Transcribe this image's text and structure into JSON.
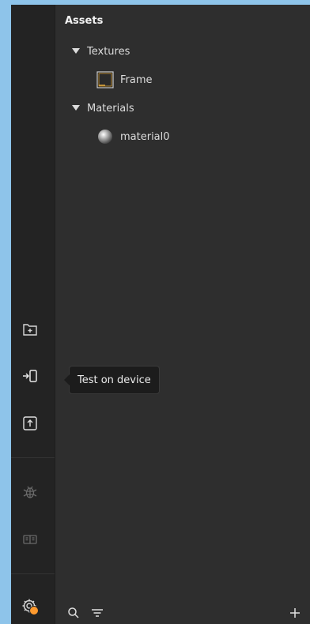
{
  "panel": {
    "title": "Assets"
  },
  "tree": {
    "textures": {
      "label": "Textures",
      "items": [
        {
          "label": "Frame",
          "icon": "texture-thumbnail-icon"
        }
      ]
    },
    "materials": {
      "label": "Materials",
      "items": [
        {
          "label": "material0",
          "icon": "material-sphere-icon"
        }
      ]
    }
  },
  "rail": {
    "buttons": [
      {
        "name": "new-folder-icon"
      },
      {
        "name": "test-on-device-icon"
      },
      {
        "name": "upload-icon"
      },
      {
        "name": "bug-icon"
      },
      {
        "name": "panel-layout-icon"
      },
      {
        "name": "settings-gear-icon"
      }
    ],
    "tooltip": "Test on device"
  },
  "bottom_bar": {
    "icons": [
      "search-icon",
      "filter-icon",
      "add-icon"
    ]
  },
  "colors": {
    "background": "#2e2e2e",
    "rail": "#232323",
    "badge": "#ff9a2e",
    "desktop": "#8ec4ea"
  }
}
